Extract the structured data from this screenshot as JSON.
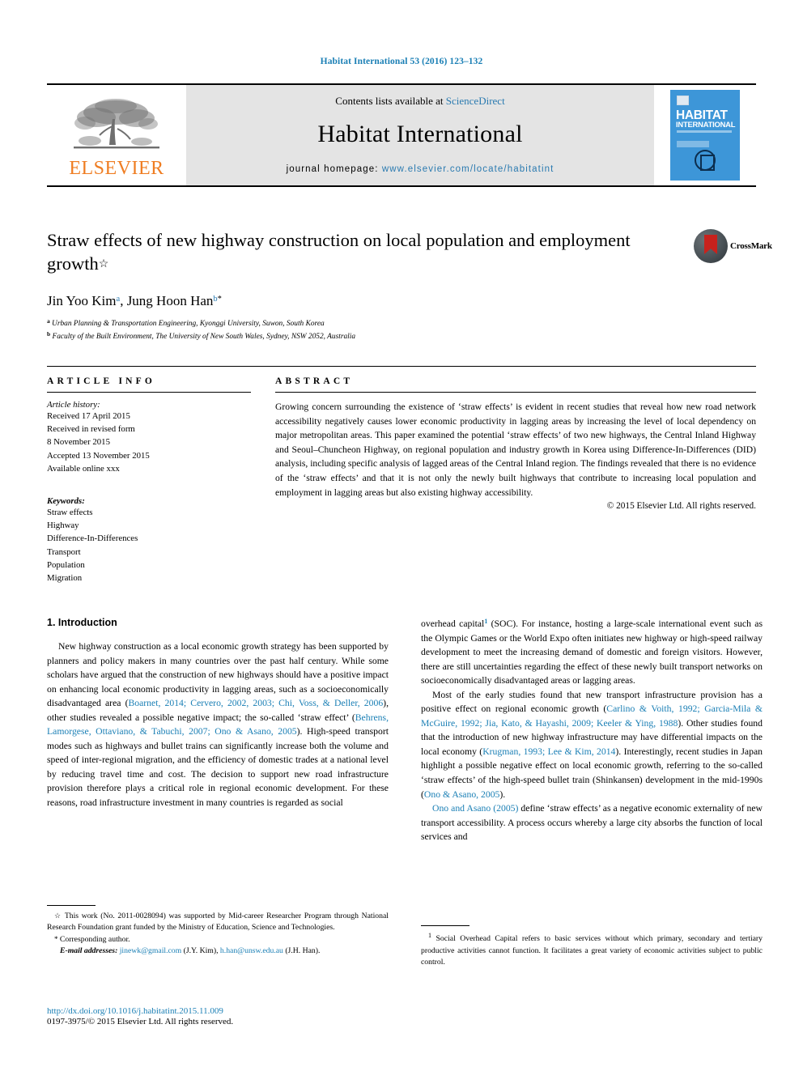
{
  "running_head": "Habitat International 53 (2016) 123–132",
  "masthead": {
    "contents_prefix": "Contents lists available at ",
    "sciencedirect": "ScienceDirect",
    "journal_name": "Habitat International",
    "homepage_label": "journal homepage: ",
    "homepage_url": "www.elsevier.com/locate/habitatint",
    "publisher_logo_text": "ELSEVIER",
    "cover_title_line1": "HABITAT",
    "cover_title_line2": "INTERNATIONAL"
  },
  "article": {
    "title": "Straw effects of new highway construction on local population and employment growth",
    "title_star": "☆",
    "authors": "Jin Yoo Kim , Jung Hoon Han",
    "author1_name": "Jin Yoo Kim",
    "author1_sup": "a",
    "author2_name": "Jung Hoon Han",
    "author2_sup": "b",
    "corresponding_mark": "*",
    "affiliation_a_sup": "a",
    "affiliation_a": "Urban Planning & Transportation Engineering, Kyonggi University, Suwon, South Korea",
    "affiliation_b_sup": "b",
    "affiliation_b": "Faculty of the Built Environment, The University of New South Wales, Sydney, NSW 2052, Australia",
    "crossmark_label": "CrossMark"
  },
  "info": {
    "heading": "ARTICLE INFO",
    "history_label": "Article history:",
    "history": [
      "Received 17 April 2015",
      "Received in revised form",
      "8 November 2015",
      "Accepted 13 November 2015",
      "Available online xxx"
    ],
    "keywords_label": "Keywords:",
    "keywords": [
      "Straw effects",
      "Highway",
      "Difference-In-Differences",
      "Transport",
      "Population",
      "Migration"
    ]
  },
  "abstract": {
    "heading": "ABSTRACT",
    "text": "Growing concern surrounding the existence of ‘straw effects’ is evident in recent studies that reveal how new road network accessibility negatively causes lower economic productivity in lagging areas by increasing the level of local dependency on major metropolitan areas. This paper examined the potential ‘straw effects’ of two new highways, the Central Inland Highway and Seoul–Chuncheon Highway, on regional population and industry growth in Korea using Difference-In-Differences (DID) analysis, including specific analysis of lagged areas of the Central Inland region. The findings revealed that there is no evidence of the ‘straw effects’ and that it is not only the newly built highways that contribute to increasing local population and employment in lagging areas but also existing highway accessibility.",
    "copyright": "© 2015 Elsevier Ltd. All rights reserved."
  },
  "body": {
    "section_heading": "1. Introduction",
    "left_para_1_a": "New highway construction as a local economic growth strategy has been supported by planners and policy makers in many countries over the past half century. While some scholars have argued that the construction of new highways should have a positive impact on enhancing local economic productivity in lagging areas, such as a socioeconomically disadvantaged area (",
    "left_cite_1": "Boarnet, 2014; Cervero, 2002, 2003; Chi, Voss, & Deller, 2006",
    "left_para_1_b": "), other studies revealed a possible negative impact; the so-called ‘straw effect’ (",
    "left_cite_2": "Behrens, Lamorgese, Ottaviano, & Tabuchi, 2007; Ono & Asano, 2005",
    "left_para_1_c": "). High-speed transport modes such as highways and bullet trains can significantly increase both the volume and speed of inter-regional migration, and the efficiency of domestic trades at a national level by reducing travel time and cost. The decision to support new road infrastructure provision therefore plays a critical role in regional economic development. For these reasons, road infrastructure investment in many countries is regarded as social",
    "right_para_1_a": "overhead capital",
    "right_footnote_mark": "1",
    "right_para_1_b": " (SOC). For instance, hosting a large-scale international event such as the Olympic Games or the World Expo often initiates new highway or high-speed railway development to meet the increasing demand of domestic and foreign visitors. However, there are still uncertainties regarding the effect of these newly built transport networks on socioeconomically disadvantaged areas or lagging areas.",
    "right_para_2_a": "Most of the early studies found that new transport infrastructure provision has a positive effect on regional economic growth (",
    "right_cite_1": "Carlino & Voith, 1992; Garcia-Mila & McGuire, 1992; Jia, Kato, & Hayashi, 2009; Keeler & Ying, 1988",
    "right_para_2_b": "). Other studies found that the introduction of new highway infrastructure may have differential impacts on the local economy (",
    "right_cite_2": "Krugman, 1993; Lee & Kim, 2014",
    "right_para_2_c": "). Interestingly, recent studies in Japan highlight a possible negative effect on local economic growth, referring to the so-called ‘straw effects’ of the high-speed bullet train (Shinkansen) development in the mid-1990s (",
    "right_cite_3": "Ono & Asano, 2005",
    "right_para_2_d": ").",
    "right_cite_4": "Ono and Asano (2005)",
    "right_para_3": " define ‘straw effects’ as a negative economic externality of new transport accessibility. A process occurs whereby a large city absorbs the function of local services and"
  },
  "footnotes": {
    "funding_mark": "☆",
    "funding": "This work (No. 2011-0028094) was supported by Mid-career Researcher Program through National Research Foundation grant funded by the Ministry of Education, Science and Technologies.",
    "corresponding_mark": "*",
    "corresponding": "Corresponding author.",
    "email_label": "E-mail addresses:",
    "email_1": "jinewk@gmail.com",
    "email_1_owner": "(J.Y. Kim)",
    "email_2": "h.han@unsw.edu.au",
    "email_2_owner": "(J.H. Han).",
    "note_mark": "1",
    "note_1": "Social Overhead Capital refers to basic services without which primary, secondary and tertiary productive activities cannot function. It facilitates a great variety of economic activities subject to public control."
  },
  "footer": {
    "doi": "http://dx.doi.org/10.1016/j.habitatint.2015.11.009",
    "issn": "0197-3975/© 2015 Elsevier Ltd. All rights reserved."
  },
  "colors": {
    "link": "#1a7fb5",
    "elsevier_orange": "#ef7d22",
    "cover_blue": "#3d96d8",
    "band_grey": "#e4e4e4"
  }
}
